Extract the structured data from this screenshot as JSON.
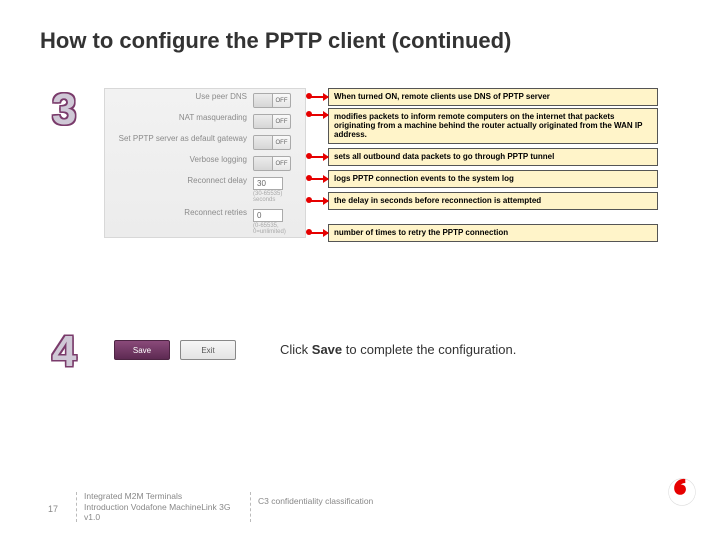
{
  "title": "How to configure the PPTP client (continued)",
  "steps": {
    "three": "3",
    "four": "4"
  },
  "config": {
    "rows": [
      {
        "label": "Use peer DNS",
        "toggle": "OFF"
      },
      {
        "label": "NAT masquerading",
        "toggle": "OFF"
      },
      {
        "label": "Set PPTP server as default gateway",
        "toggle": "OFF"
      },
      {
        "label": "Verbose logging",
        "toggle": "OFF"
      },
      {
        "label": "Reconnect delay",
        "value": "30",
        "hint": "(30-65535) seconds"
      },
      {
        "label": "Reconnect retries",
        "value": "0",
        "hint": "(0-65535, 0=unlimited)"
      }
    ]
  },
  "callouts": [
    "When turned ON, remote clients use DNS of PPTP server",
    "modifies packets to inform remote computers on the internet that packets originating from a machine behind the router actually originated from the WAN IP address.",
    "sets all outbound data packets to go through PPTP tunnel",
    "logs PPTP connection events to the system log",
    "the delay in seconds before reconnection is attempted",
    "number of times to retry the PPTP connection"
  ],
  "buttons": {
    "save": "Save",
    "exit": "Exit"
  },
  "step4_pre": "Click ",
  "step4_bold": "Save",
  "step4_post": " to complete the configuration.",
  "footer": {
    "page": "17",
    "col1_line1": "Integrated M2M Terminals",
    "col1_line2": "Introduction Vodafone MachineLink 3G v1.0",
    "col2": "C3 confidentiality classification"
  }
}
